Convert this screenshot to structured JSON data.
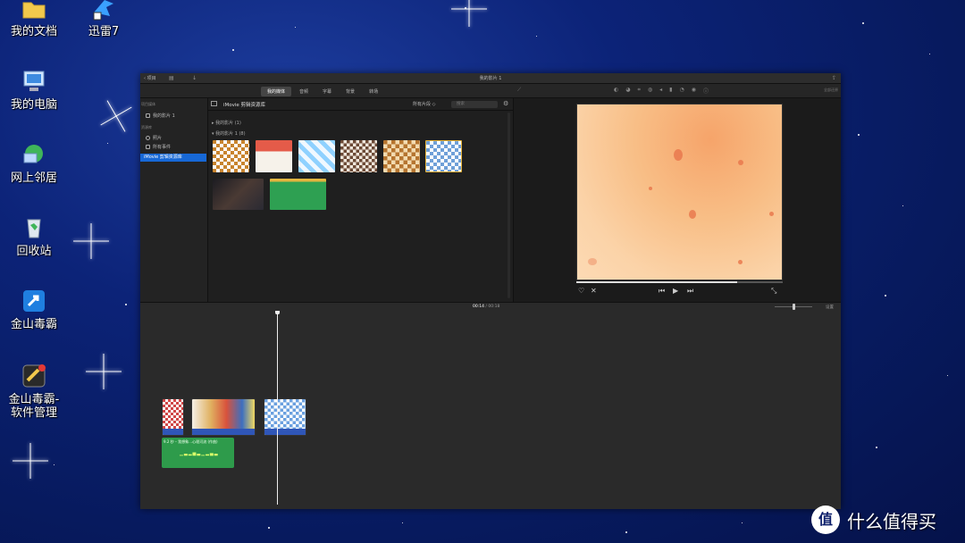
{
  "desktop": {
    "icons": [
      {
        "label": "我的文档"
      },
      {
        "label": "迅雷7"
      },
      {
        "label": "我的电脑"
      },
      {
        "label": "网上邻居"
      },
      {
        "label": "回收站"
      },
      {
        "label": "金山毒霸"
      },
      {
        "label": "金山毒霸-\n软件管理"
      }
    ]
  },
  "window": {
    "title": "我的影片 1",
    "back_label": "项目",
    "tabs": [
      {
        "label": "我的媒体"
      },
      {
        "label": "音频"
      },
      {
        "label": "字幕"
      },
      {
        "label": "背景"
      },
      {
        "label": "转场"
      }
    ],
    "reset_label": "全部还原"
  },
  "library": {
    "project_header": "项目媒体",
    "project_item": "我的影片 1",
    "libraries_header": "资源库",
    "items": [
      {
        "label": "照片"
      },
      {
        "label": "所有事件"
      },
      {
        "label": "iMovie 剪辑资源库"
      }
    ]
  },
  "browser": {
    "title": "iMovie 剪辑资源库",
    "filter": "所有片段 ◇",
    "search_placeholder": "搜索",
    "groups": [
      {
        "label": "▸  我的影片  (1)"
      },
      {
        "label": "▾  我的影片 1  (8)"
      }
    ]
  },
  "timeline": {
    "current_time": "00:14",
    "separator": "/",
    "total_time": "00:18",
    "settings_label": "设置",
    "audio_clip_label": "9.2 秒 – 我想象…心理河流 (作曲)"
  },
  "watermark": {
    "logo": "值",
    "text": "什么值得买"
  },
  "colors": {
    "accent": "#1768d6",
    "audio_clip": "#2e9b4b",
    "video_strip": "#2f56b8"
  }
}
